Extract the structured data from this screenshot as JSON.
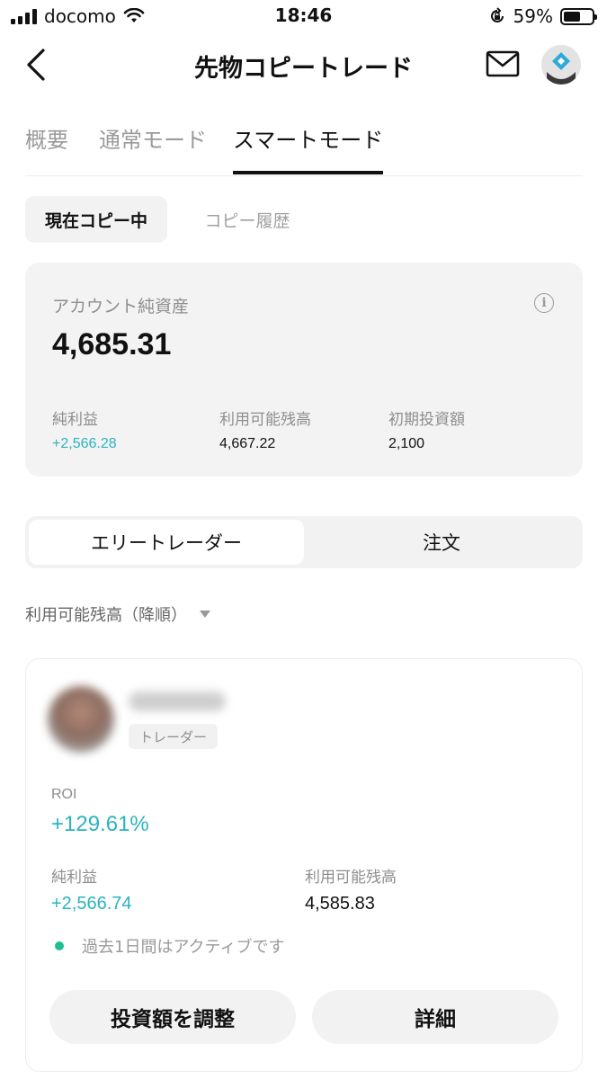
{
  "status_bar": {
    "carrier": "docomo",
    "time": "18:46",
    "battery": "59%",
    "battery_level": 0.59
  },
  "header": {
    "title": "先物コピートレード",
    "back_icon": "chevron-left-icon",
    "mail_icon": "mail-icon",
    "avatar_icon": "user-avatar-icon"
  },
  "tabs": [
    {
      "label": "概要",
      "active": false
    },
    {
      "label": "通常モード",
      "active": false
    },
    {
      "label": "スマートモード",
      "active": true
    }
  ],
  "subtabs": [
    {
      "label": "現在コピー中",
      "active": true
    },
    {
      "label": "コピー履歴",
      "active": false
    }
  ],
  "account": {
    "label": "アカウント純資産",
    "value": "4,685.31",
    "info_icon": "i",
    "stats": [
      {
        "label": "純利益",
        "value": "+2,566.28",
        "positive": true
      },
      {
        "label": "利用可能残高",
        "value": "4,667.22",
        "positive": false
      },
      {
        "label": "初期投資額",
        "value": "2,100",
        "positive": false
      }
    ]
  },
  "segmented": {
    "options": [
      "エリートレーダー",
      "注文"
    ],
    "selected": "エリートレーダー"
  },
  "sort": {
    "label": "利用可能残高（降順）"
  },
  "trader_card": {
    "badge": "トレーダー",
    "roi_label": "ROI",
    "roi_value": "+129.61%",
    "stats": [
      {
        "label": "純利益",
        "value": "+2,566.74",
        "positive": true
      },
      {
        "label": "利用可能残高",
        "value": "4,585.83",
        "positive": false
      }
    ],
    "activity": "過去1日間はアクティブです",
    "buttons": {
      "adjust": "投資額を調整",
      "details": "詳細"
    }
  },
  "colors": {
    "accent_positive": "#2bb3c2",
    "active_dot": "#1fbf8f",
    "card_bg": "#f3f3f4"
  }
}
